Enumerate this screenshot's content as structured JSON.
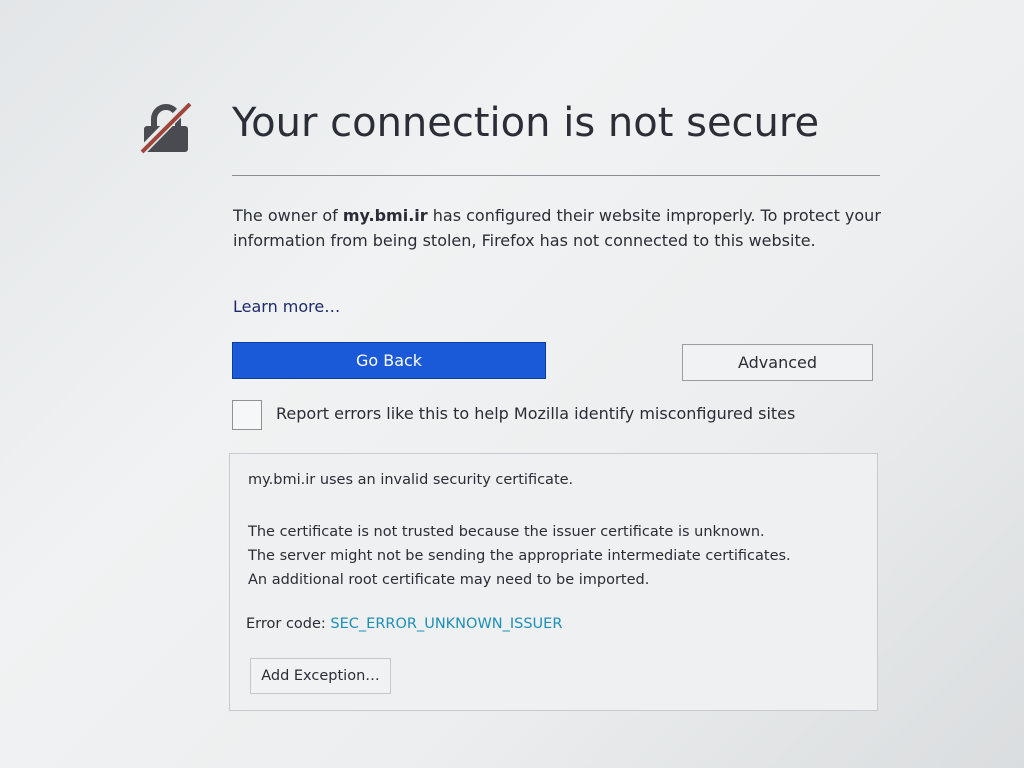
{
  "header": {
    "title": "Your connection is not secure"
  },
  "intro": {
    "text_before": "The owner of ",
    "domain": "my.bmi.ir",
    "text_after": " has configured their website improperly. To protect your information from being stolen, Firefox has not connected to this website."
  },
  "links": {
    "learn_more": "Learn more…"
  },
  "buttons": {
    "go_back": "Go Back",
    "advanced": "Advanced",
    "add_exception": "Add Exception…"
  },
  "report": {
    "label": "Report errors like this to help Mozilla identify misconfigured sites",
    "checked": false
  },
  "advanced_panel": {
    "line1": "my.bmi.ir uses an invalid security certificate.",
    "details": [
      "The certificate is not trusted because the issuer certificate is unknown.",
      "The server might not be sending the appropriate intermediate certificates.",
      "An additional root certificate may need to be imported."
    ],
    "error_label": "Error code: ",
    "error_code": "SEC_ERROR_UNKNOWN_ISSUER"
  },
  "icons": {
    "lock": "broken-lock-icon"
  },
  "colors": {
    "primary_button": "#1a5ad8",
    "error_code_link": "#1e8fb6",
    "lock_body": "#4a4b50",
    "lock_slash": "#a0453a"
  }
}
